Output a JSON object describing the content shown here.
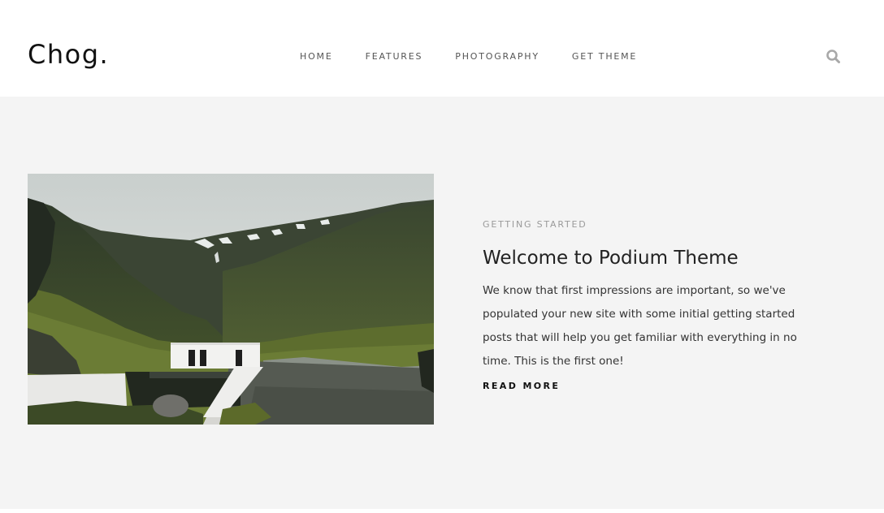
{
  "site": {
    "logo": "Chog."
  },
  "nav": {
    "items": [
      {
        "label": "HOME"
      },
      {
        "label": "FEATURES"
      },
      {
        "label": "PHOTOGRAPHY"
      },
      {
        "label": "GET THEME"
      }
    ],
    "search_icon": "search-icon"
  },
  "post": {
    "tag": "GETTING STARTED",
    "title": "Welcome to Podium Theme",
    "excerpt": "We know that first impressions are important, so we've populated your new site with some initial getting started posts that will help you get familiar with everything in no time. This is the first one!",
    "read_more": "READ MORE",
    "image_alt": "landscape-photo"
  },
  "colors": {
    "page_bg": "#f4f4f4",
    "header_bg": "#ffffff",
    "text_dark": "#222222",
    "text_muted": "#9a9a9a",
    "nav_text": "#555555"
  }
}
